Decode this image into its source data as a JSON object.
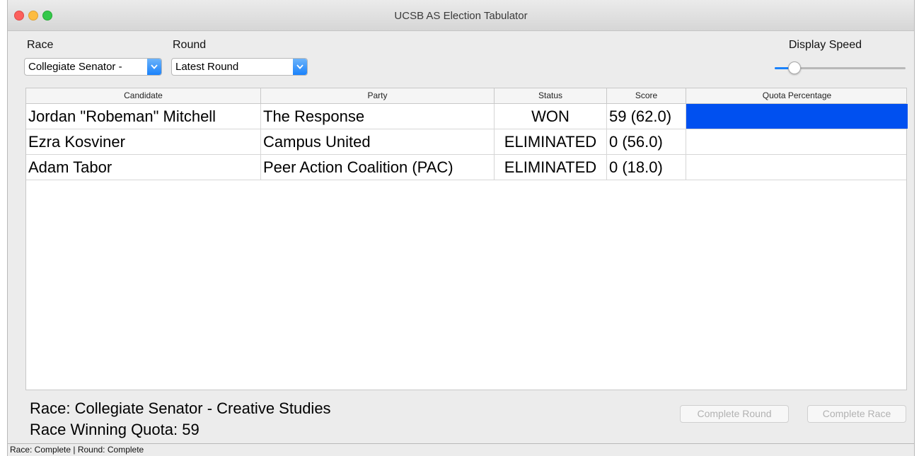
{
  "window": {
    "title": "UCSB AS Election Tabulator"
  },
  "controls": {
    "race_label": "Race",
    "race_value": "Collegiate Senator -",
    "round_label": "Round",
    "round_value": "Latest Round",
    "speed_label": "Display Speed",
    "speed_level": 0.15
  },
  "table": {
    "headers": {
      "candidate": "Candidate",
      "party": "Party",
      "status": "Status",
      "score": "Score",
      "quota": "Quota Percentage"
    },
    "rows": [
      {
        "candidate": "Jordan \"Robeman\" Mitchell",
        "party": "The Response",
        "status": "WON",
        "score": "59 (62.0)",
        "quota_fraction": 1.0
      },
      {
        "candidate": "Ezra Kosviner",
        "party": "Campus United",
        "status": "ELIMINATED",
        "score": "0 (56.0)",
        "quota_fraction": 0
      },
      {
        "candidate": "Adam Tabor",
        "party": "Peer Action Coalition (PAC)",
        "status": "ELIMINATED",
        "score": "0 (18.0)",
        "quota_fraction": 0
      }
    ]
  },
  "summary": {
    "race_line": "Race: Collegiate Senator - Creative Studies",
    "quota_line": "Race Winning Quota: 59"
  },
  "buttons": {
    "complete_round": "Complete Round",
    "complete_race": "Complete Race"
  },
  "status_bar": "Race: Complete | Round: Complete",
  "colors": {
    "accent": "#1a82fb",
    "quota_bar": "#0050f0"
  }
}
